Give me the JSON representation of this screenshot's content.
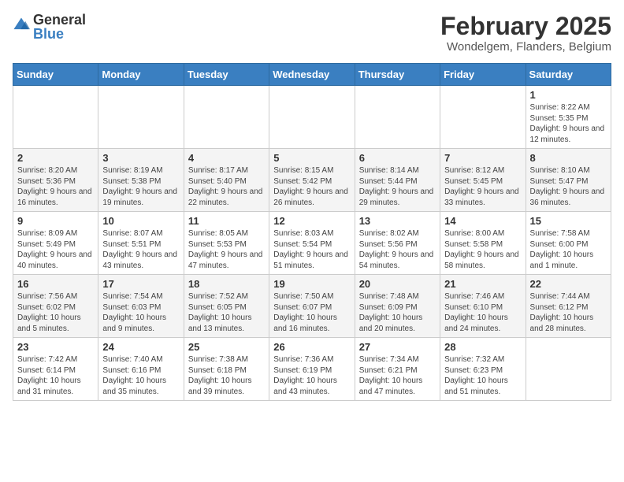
{
  "header": {
    "logo_general": "General",
    "logo_blue": "Blue",
    "month_title": "February 2025",
    "location": "Wondelgem, Flanders, Belgium"
  },
  "days_of_week": [
    "Sunday",
    "Monday",
    "Tuesday",
    "Wednesday",
    "Thursday",
    "Friday",
    "Saturday"
  ],
  "weeks": [
    [
      {
        "day": "",
        "info": ""
      },
      {
        "day": "",
        "info": ""
      },
      {
        "day": "",
        "info": ""
      },
      {
        "day": "",
        "info": ""
      },
      {
        "day": "",
        "info": ""
      },
      {
        "day": "",
        "info": ""
      },
      {
        "day": "1",
        "info": "Sunrise: 8:22 AM\nSunset: 5:35 PM\nDaylight: 9 hours and 12 minutes."
      }
    ],
    [
      {
        "day": "2",
        "info": "Sunrise: 8:20 AM\nSunset: 5:36 PM\nDaylight: 9 hours and 16 minutes."
      },
      {
        "day": "3",
        "info": "Sunrise: 8:19 AM\nSunset: 5:38 PM\nDaylight: 9 hours and 19 minutes."
      },
      {
        "day": "4",
        "info": "Sunrise: 8:17 AM\nSunset: 5:40 PM\nDaylight: 9 hours and 22 minutes."
      },
      {
        "day": "5",
        "info": "Sunrise: 8:15 AM\nSunset: 5:42 PM\nDaylight: 9 hours and 26 minutes."
      },
      {
        "day": "6",
        "info": "Sunrise: 8:14 AM\nSunset: 5:44 PM\nDaylight: 9 hours and 29 minutes."
      },
      {
        "day": "7",
        "info": "Sunrise: 8:12 AM\nSunset: 5:45 PM\nDaylight: 9 hours and 33 minutes."
      },
      {
        "day": "8",
        "info": "Sunrise: 8:10 AM\nSunset: 5:47 PM\nDaylight: 9 hours and 36 minutes."
      }
    ],
    [
      {
        "day": "9",
        "info": "Sunrise: 8:09 AM\nSunset: 5:49 PM\nDaylight: 9 hours and 40 minutes."
      },
      {
        "day": "10",
        "info": "Sunrise: 8:07 AM\nSunset: 5:51 PM\nDaylight: 9 hours and 43 minutes."
      },
      {
        "day": "11",
        "info": "Sunrise: 8:05 AM\nSunset: 5:53 PM\nDaylight: 9 hours and 47 minutes."
      },
      {
        "day": "12",
        "info": "Sunrise: 8:03 AM\nSunset: 5:54 PM\nDaylight: 9 hours and 51 minutes."
      },
      {
        "day": "13",
        "info": "Sunrise: 8:02 AM\nSunset: 5:56 PM\nDaylight: 9 hours and 54 minutes."
      },
      {
        "day": "14",
        "info": "Sunrise: 8:00 AM\nSunset: 5:58 PM\nDaylight: 9 hours and 58 minutes."
      },
      {
        "day": "15",
        "info": "Sunrise: 7:58 AM\nSunset: 6:00 PM\nDaylight: 10 hours and 1 minute."
      }
    ],
    [
      {
        "day": "16",
        "info": "Sunrise: 7:56 AM\nSunset: 6:02 PM\nDaylight: 10 hours and 5 minutes."
      },
      {
        "day": "17",
        "info": "Sunrise: 7:54 AM\nSunset: 6:03 PM\nDaylight: 10 hours and 9 minutes."
      },
      {
        "day": "18",
        "info": "Sunrise: 7:52 AM\nSunset: 6:05 PM\nDaylight: 10 hours and 13 minutes."
      },
      {
        "day": "19",
        "info": "Sunrise: 7:50 AM\nSunset: 6:07 PM\nDaylight: 10 hours and 16 minutes."
      },
      {
        "day": "20",
        "info": "Sunrise: 7:48 AM\nSunset: 6:09 PM\nDaylight: 10 hours and 20 minutes."
      },
      {
        "day": "21",
        "info": "Sunrise: 7:46 AM\nSunset: 6:10 PM\nDaylight: 10 hours and 24 minutes."
      },
      {
        "day": "22",
        "info": "Sunrise: 7:44 AM\nSunset: 6:12 PM\nDaylight: 10 hours and 28 minutes."
      }
    ],
    [
      {
        "day": "23",
        "info": "Sunrise: 7:42 AM\nSunset: 6:14 PM\nDaylight: 10 hours and 31 minutes."
      },
      {
        "day": "24",
        "info": "Sunrise: 7:40 AM\nSunset: 6:16 PM\nDaylight: 10 hours and 35 minutes."
      },
      {
        "day": "25",
        "info": "Sunrise: 7:38 AM\nSunset: 6:18 PM\nDaylight: 10 hours and 39 minutes."
      },
      {
        "day": "26",
        "info": "Sunrise: 7:36 AM\nSunset: 6:19 PM\nDaylight: 10 hours and 43 minutes."
      },
      {
        "day": "27",
        "info": "Sunrise: 7:34 AM\nSunset: 6:21 PM\nDaylight: 10 hours and 47 minutes."
      },
      {
        "day": "28",
        "info": "Sunrise: 7:32 AM\nSunset: 6:23 PM\nDaylight: 10 hours and 51 minutes."
      },
      {
        "day": "",
        "info": ""
      }
    ]
  ]
}
